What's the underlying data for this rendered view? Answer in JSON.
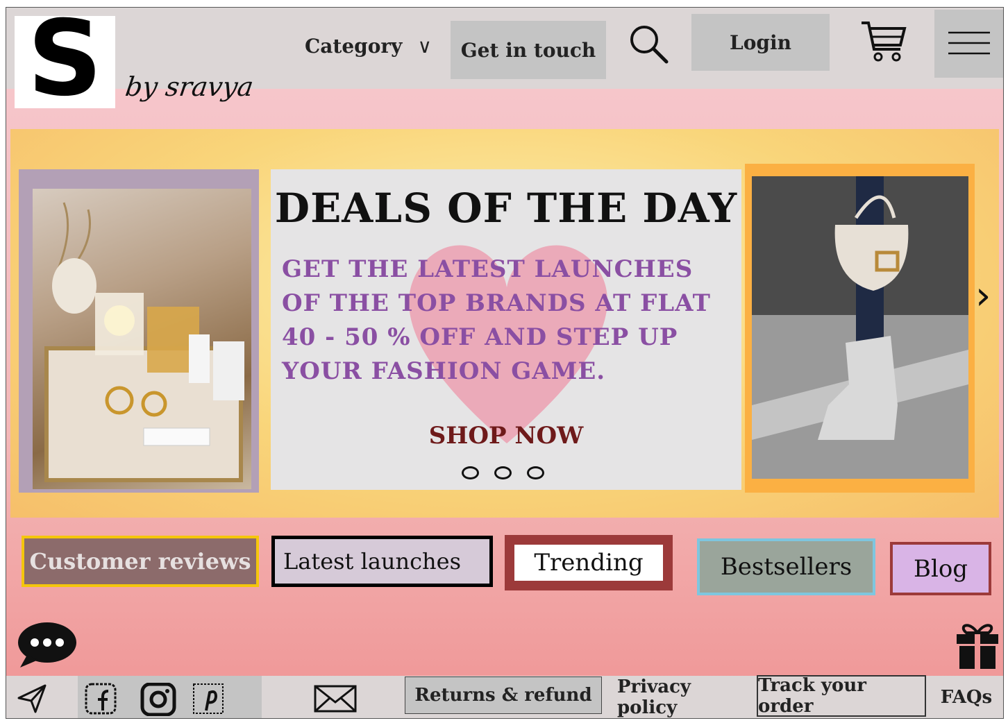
{
  "brand": {
    "logo_letter": "S",
    "tagline": "by sravya"
  },
  "nav": {
    "category_label": "Category",
    "contact_label": "Get in touch",
    "login_label": "Login"
  },
  "hero": {
    "title": "DEALS OF THE DAY",
    "text": "GET THE LATEST LAUNCHES OF THE TOP BRANDS AT FLAT 40 - 50 % OFF AND STEP UP YOUR FASHION GAME.",
    "cta": "SHOP NOW"
  },
  "chips": {
    "reviews": "Customer reviews",
    "latest": "Latest launches",
    "trending": "Trending",
    "bestsellers": "Bestsellers",
    "blog": "Blog"
  },
  "footer": {
    "returns": "Returns & refund",
    "privacy": "Privacy policy",
    "track": "Track your order",
    "faqs": "FAQs"
  },
  "colors": {
    "header_bg": "#dcd6d6",
    "button_grey": "#c4c4c4",
    "deal_text": "#8a4fa3",
    "cta": "#6e1a1a",
    "reviews_border": "#f4c60c",
    "bestsellers_border": "#7ec6df",
    "trending_bg": "#9c3a3a",
    "blog_bg": "#d9b4e6"
  },
  "icons": [
    "search-icon",
    "cart-icon",
    "hamburger-menu-icon",
    "chevron-down-icon",
    "chevron-right-icon",
    "chat-icon",
    "gift-icon",
    "send-icon",
    "facebook-icon",
    "instagram-icon",
    "pinterest-icon",
    "mail-icon"
  ]
}
